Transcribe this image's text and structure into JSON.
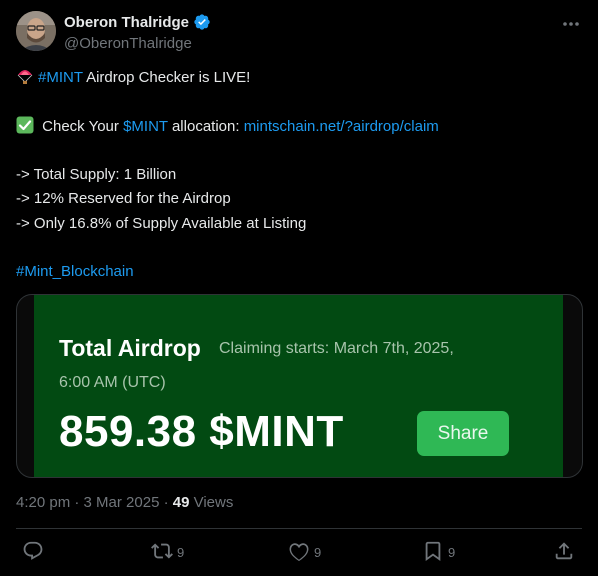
{
  "author": {
    "display_name": "Oberon Thalridge",
    "handle": "@OberonThalridge",
    "verified": true
  },
  "post": {
    "line1_hashtag": "#MINT",
    "line1_text": " Airdrop Checker is LIVE!",
    "line2_prefix": " Check Your ",
    "line2_cashtag": "$MINT",
    "line2_middle": " allocation: ",
    "line2_link": "mintschain.net/?airdrop/claim",
    "bullets": [
      "-> Total Supply: 1 Billion",
      "-> 12% Reserved for the Airdrop",
      "-> Only 16.8% of Supply Available at Listing"
    ],
    "hashtag": "#Mint_Blockchain"
  },
  "media": {
    "title": "Total Airdrop",
    "subtitle_line1": "Claiming starts: March 7th, 2025,",
    "subtitle_line2": "6:00 AM (UTC)",
    "amount": "859.38 $MINT",
    "share_label": "Share"
  },
  "meta": {
    "time_date": "4:20 pm · 3 Mar 2025 · ",
    "views_count": "49",
    "views_label": " Views"
  },
  "actions": {
    "replies": "",
    "reposts": "9",
    "likes": "9",
    "bookmarks": "9"
  },
  "colors": {
    "background": "#000000",
    "link": "#1d9bf0",
    "card_green": "#024a12",
    "share_button": "#2fb855",
    "muted": "#71767b"
  },
  "icons": [
    "avatar",
    "verified-badge-icon",
    "more-icon",
    "parachute-emoji-icon",
    "check-emoji-icon",
    "reply-icon",
    "repost-icon",
    "like-icon",
    "bookmark-icon",
    "share-icon"
  ]
}
